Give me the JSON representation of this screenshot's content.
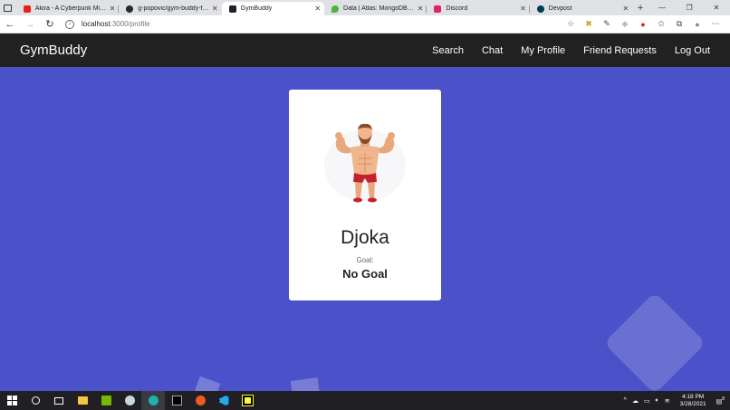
{
  "browser": {
    "tabs": [
      {
        "title": "Akira - A Cyberpunk Mix - Y",
        "favicon": "youtube-icon",
        "color": "#e62117",
        "active": false
      },
      {
        "title": "g-popovic/gym-buddy-finde",
        "favicon": "github-icon",
        "color": "#24292e",
        "active": false
      },
      {
        "title": "GymBuddy",
        "favicon": "react-app-icon",
        "color": "#20232a",
        "active": true
      },
      {
        "title": "Data | Atlas: MongoDB Atlas",
        "favicon": "mongodb-leaf-icon",
        "color": "#4db33d",
        "active": false
      },
      {
        "title": "Discord",
        "favicon": "discord-icon",
        "color": "#e0245e",
        "active": false
      },
      {
        "title": "Devpost",
        "favicon": "devpost-icon",
        "color": "#003e54",
        "active": false
      }
    ],
    "close_glyph": "✕",
    "new_tab_glyph": "+",
    "url_host": "localhost",
    "url_path": ":3000/profile"
  },
  "app": {
    "brand": "GymBuddy",
    "nav": {
      "search": "Search",
      "chat": "Chat",
      "my_profile": "My Profile",
      "friend_requests": "Friend Requests",
      "log_out": "Log Out"
    },
    "background_color": "#4a51c9"
  },
  "profile": {
    "name": "Djoka",
    "goal_label": "Goal:",
    "goal_value": "No Goal",
    "avatar_icon": "muscular-man-flexing-icon"
  },
  "taskbar": {
    "time": "4:18 PM",
    "date": "3/28/2021",
    "notification_count": "8"
  }
}
